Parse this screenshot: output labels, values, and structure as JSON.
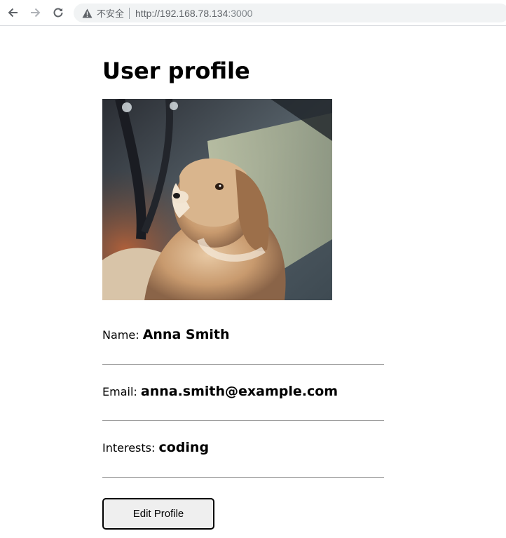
{
  "browser": {
    "security_label": "不安全",
    "url_host": "http://192.168.78.134",
    "url_port": ":3000",
    "icons": [
      "back-arrow-icon",
      "forward-arrow-icon",
      "reload-icon",
      "warning-icon"
    ]
  },
  "profile": {
    "title": "User profile",
    "photo_icon": "dog-photo",
    "fields": {
      "name_label": "Name:",
      "name_value": "Anna Smith",
      "email_label": "Email:",
      "email_value": "anna.smith@example.com",
      "interests_label": "Interests:",
      "interests_value": "coding"
    },
    "edit_button_label": "Edit Profile"
  },
  "colors": {
    "omnibox_bg": "#f1f3f4",
    "divider": "#9e9e9e",
    "button_bg": "#efefef"
  }
}
